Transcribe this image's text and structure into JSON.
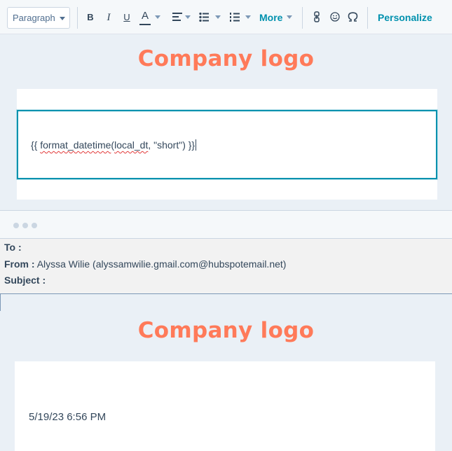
{
  "toolbar": {
    "paragraph_select": "Paragraph",
    "bold": "B",
    "italic": "I",
    "underline": "U",
    "text_color": "A",
    "more_label": "More",
    "personalize_label": "Personalize",
    "icons": [
      "bold-icon",
      "italic-icon",
      "underline-icon",
      "text-color-icon",
      "align-icon",
      "bulleted-list-icon",
      "numbered-list-icon",
      "link-icon",
      "emoji-icon",
      "special-character-icon"
    ]
  },
  "editor": {
    "logo_text": "Company logo",
    "code_prefix": "{{ ",
    "code_func": "format_datetime",
    "code_open": "(",
    "code_arg": "local_dt",
    "code_rest": ", \"short\") }}"
  },
  "preview": {
    "to_label": "To :",
    "to_value": "",
    "from_label": "From :",
    "from_value": "Alyssa Wilie (alyssamwilie.gmail.com@hubspotemail.net)",
    "subject_label": "Subject :",
    "subject_value": "",
    "logo_text": "Company logo",
    "date_output": "5/19/23 6:56 PM"
  },
  "colors": {
    "accent": "#0091ae",
    "logo": "#ff7a59",
    "text": "#33475b",
    "background": "#eaf0f6"
  }
}
